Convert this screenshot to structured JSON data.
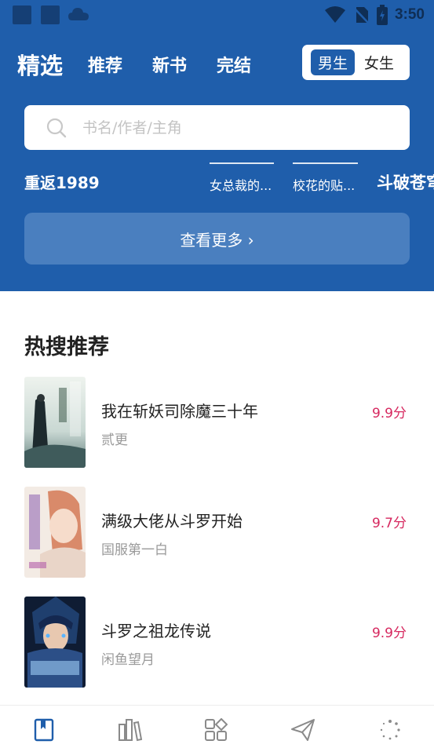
{
  "status_bar": {
    "time": "3:50"
  },
  "header": {
    "tabs": [
      {
        "label": "精选",
        "active": true
      },
      {
        "label": "推荐",
        "active": false
      },
      {
        "label": "新书",
        "active": false
      },
      {
        "label": "完结",
        "active": false
      }
    ],
    "gender": {
      "male": "男生",
      "female": "女生",
      "selected": "男生"
    },
    "search": {
      "placeholder": "书名/作者/主角",
      "value": ""
    },
    "hot_words": [
      "重返1989",
      "女总裁的...",
      "校花的贴...",
      "斗破苍穹"
    ],
    "more_label": "查看更多 ›"
  },
  "section": {
    "title": "热搜推荐"
  },
  "books": [
    {
      "title": "我在斩妖司除魔三十年",
      "author": "贰更",
      "score": "9.9分"
    },
    {
      "title": "满级大佬从斗罗开始",
      "author": "国服第一白",
      "score": "9.7分"
    },
    {
      "title": "斗罗之祖龙传说",
      "author": "闲鱼望月",
      "score": "9.9分"
    }
  ],
  "bottom_nav": {
    "items": [
      "book-icon",
      "bookshelf-icon",
      "category-icon",
      "send-icon",
      "loading-icon"
    ],
    "active": "book-icon"
  },
  "colors": {
    "primary": "#1f5eab",
    "score": "#d6285f",
    "more_button": "#4a7fbf"
  }
}
